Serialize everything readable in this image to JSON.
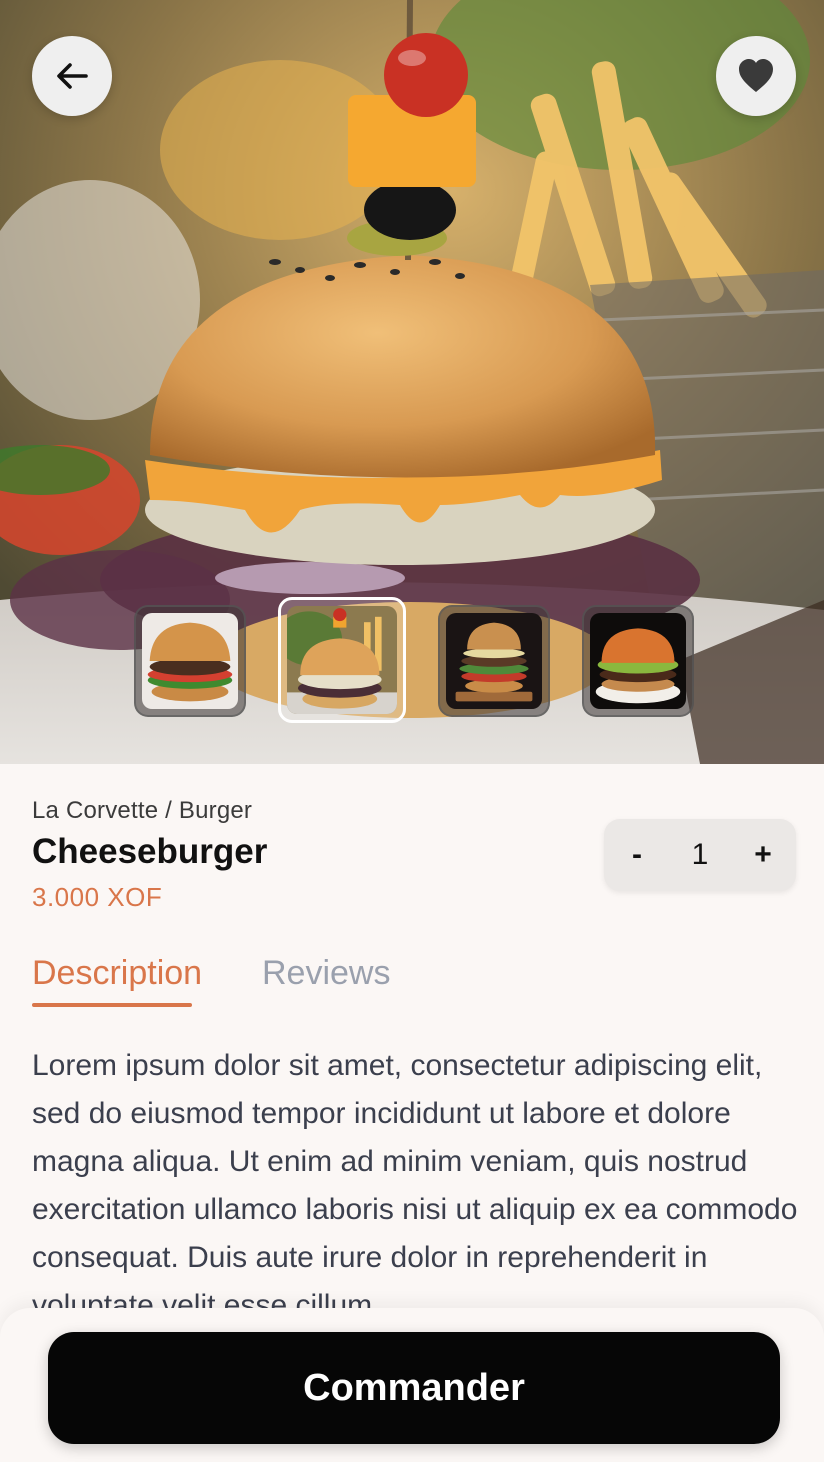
{
  "header": {
    "back_icon": "arrow-left-icon",
    "favorite_icon": "heart-icon"
  },
  "gallery": {
    "thumbnails": [
      {
        "name": "burger-photo-1",
        "selected": false
      },
      {
        "name": "burger-photo-2",
        "selected": true
      },
      {
        "name": "burger-photo-3",
        "selected": false
      },
      {
        "name": "burger-photo-4",
        "selected": false
      }
    ]
  },
  "product": {
    "breadcrumb": "La Corvette / Burger",
    "name": "Cheeseburger",
    "price": "3.000 XOF"
  },
  "quantity": {
    "minus_label": "-",
    "value": "1",
    "plus_label": "+"
  },
  "tabs": [
    {
      "label": "Description",
      "active": true
    },
    {
      "label": "Reviews",
      "active": false
    }
  ],
  "description": "Lorem ipsum dolor sit amet, consectetur adipiscing elit, sed do eiusmod tempor incididunt ut labore et dolore magna aliqua. Ut enim ad minim veniam, quis nostrud exercitation ullamco laboris nisi ut aliquip ex ea commodo consequat. Duis aute irure dolor in reprehenderit in voluptate velit esse cillum",
  "cta": {
    "label": "Commander"
  },
  "colors": {
    "accent": "#d9764a",
    "inactive_tab": "#9aa0ad",
    "button_bg": "#060606",
    "background": "#fbf7f5"
  }
}
